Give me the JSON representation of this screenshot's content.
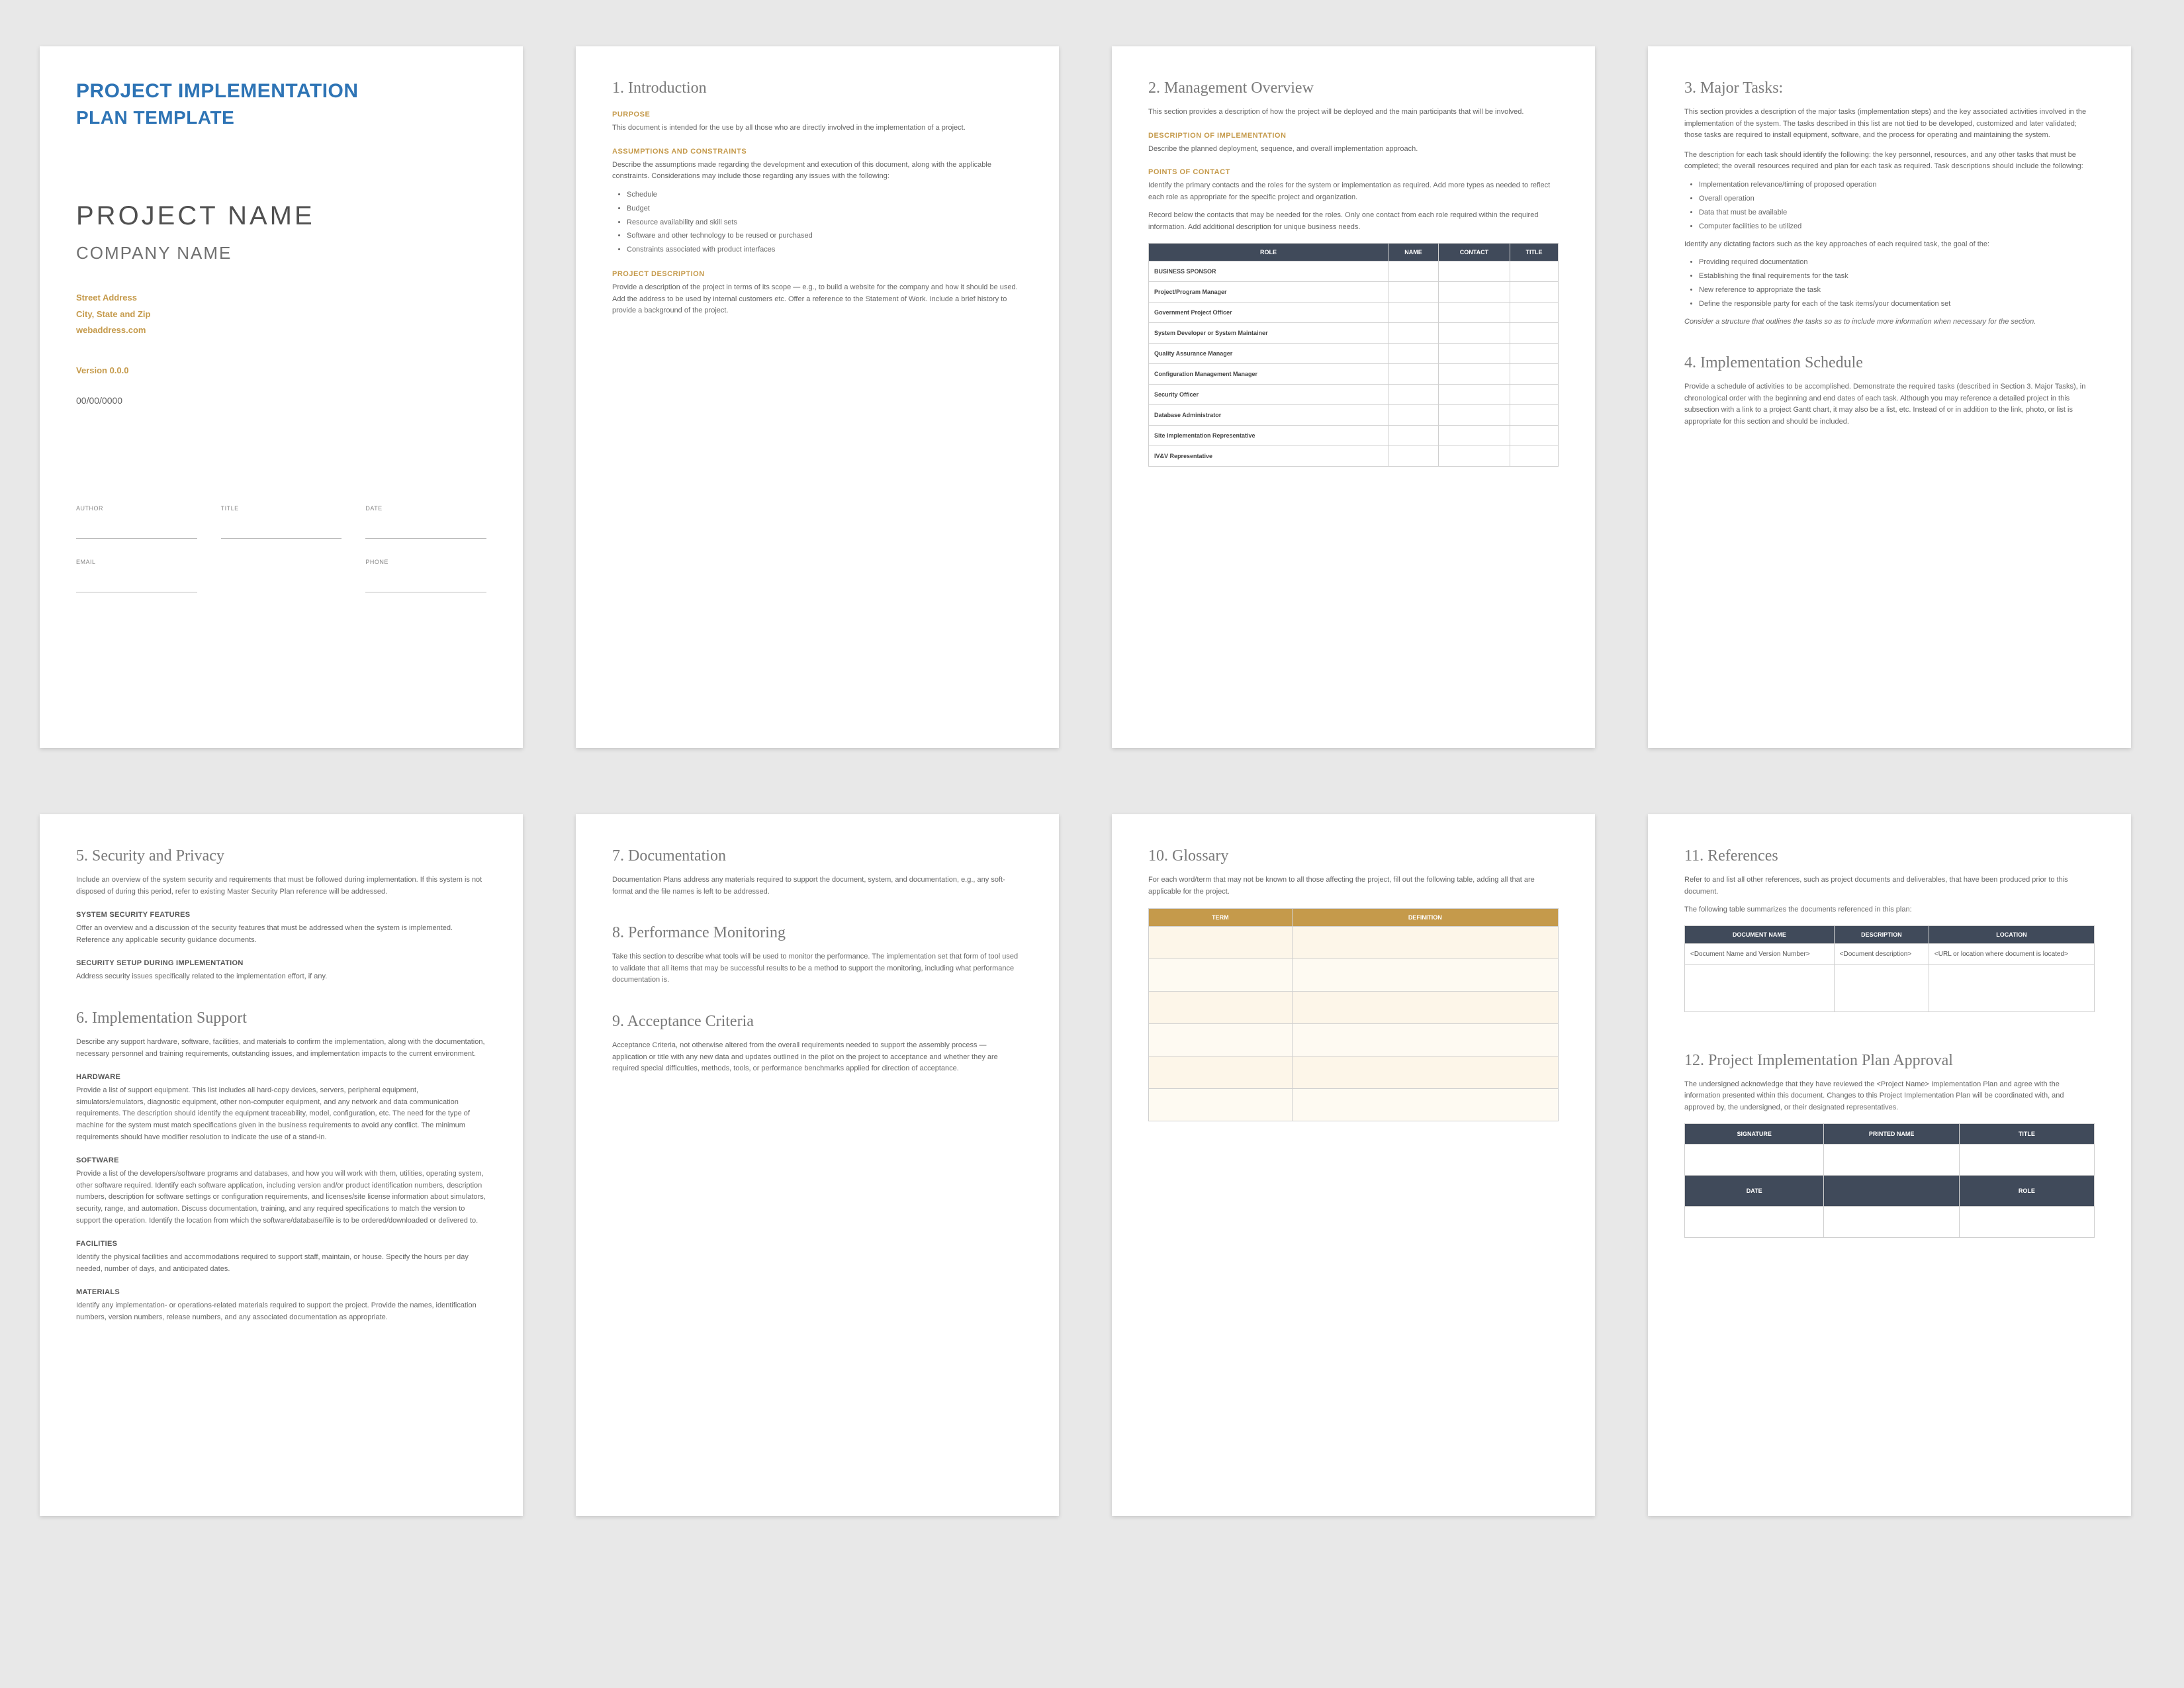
{
  "cover": {
    "title1": "PROJECT IMPLEMENTATION",
    "title2": "PLAN TEMPLATE",
    "project": "PROJECT NAME",
    "company": "COMPANY NAME",
    "addr1": "Street Address",
    "addr2": "City, State and Zip",
    "addr3": "webaddress.com",
    "version": "Version 0.0.0",
    "date": "00/00/0000",
    "sig": {
      "auth": "AUTHOR",
      "title": "TITLE",
      "date": "DATE",
      "email": "EMAIL",
      "phone": "PHONE"
    }
  },
  "s1": {
    "heading": "1. Introduction",
    "purpose_h": "PURPOSE",
    "purpose": "This document is intended for the use by all those who are directly involved in the implementation of a project.",
    "assump_h": "ASSUMPTIONS AND CONSTRAINTS",
    "assump": "Describe the assumptions made regarding the development and execution of this document, along with the applicable constraints. Considerations may include those regarding any issues with the following:",
    "assump_items": [
      "Schedule",
      "Budget",
      "Resource availability and skill sets",
      "Software and other technology to be reused or purchased",
      "Constraints associated with product interfaces"
    ],
    "proj_h": "PROJECT DESCRIPTION",
    "proj": "Provide a description of the project in terms of its scope — e.g., to build a website for the company and how it should be used. Add the address to be used by internal customers etc. Offer a reference to the Statement of Work. Include a brief history to provide a background of the project."
  },
  "s2": {
    "heading": "2. Management Overview",
    "intro": "This section provides a description of how the project will be deployed and the main participants that will be involved.",
    "desc_h": "DESCRIPTION OF IMPLEMENTATION",
    "desc": "Describe the planned deployment, sequence, and overall implementation approach.",
    "poc_h": "POINTS OF CONTACT",
    "poc": "Identify the primary contacts and the roles for the system or implementation as required. Add more types as needed to reflect each role as appropriate for the specific project and organization.",
    "below": "Record below the contacts that may be needed for the roles. Only one contact from each role required within the required information. Add additional description for unique business needs.",
    "table": {
      "headers": [
        "ROLE",
        "NAME",
        "CONTACT",
        "TITLE"
      ],
      "rows": [
        "BUSINESS SPONSOR",
        "Project/Program Manager",
        "Government Project Officer",
        "System Developer or System Maintainer",
        "Quality Assurance Manager",
        "Configuration Management Manager",
        "Security Officer",
        "Database Administrator",
        "Site Implementation Representative",
        "IV&V Representative"
      ]
    }
  },
  "s3": {
    "heading": "3. Major Tasks:",
    "intro": "This section provides a description of the major tasks (implementation steps) and the key associated activities involved in the implementation of the system. The tasks described in this list are not tied to be developed, customized and later validated; those tasks are required to install equipment, software, and the process for operating and maintaining the system.",
    "para2": "The description for each task should identify the following: the key personnel, resources, and any other tasks that must be completed; the overall resources required and plan for each task as required. Task descriptions should include the following:",
    "list1": [
      "Implementation relevance/timing of proposed operation",
      "Overall operation",
      "Data that must be available",
      "Computer facilities to be utilized"
    ],
    "mid": "Identify any dictating factors such as the key approaches of each required task, the goal of the:",
    "list2": [
      "Providing required documentation",
      "Establishing the final requirements for the task",
      "New reference to appropriate the task",
      "Define the responsible party for each of the task items/your documentation set"
    ],
    "end": "Consider a structure that outlines the tasks so as to include more information when necessary for the section."
  },
  "s4": {
    "heading": "4. Implementation Schedule",
    "body": "Provide a schedule of activities to be accomplished. Demonstrate the required tasks (described in Section 3. Major Tasks), in chronological order with the beginning and end dates of each task. Although you may reference a detailed project in this subsection with a link to a project Gantt chart, it may also be a list, etc. Instead of or in addition to the link, photo, or list is appropriate for this section and should be included."
  },
  "s5": {
    "heading": "5. Security and Privacy",
    "intro": "Include an overview of the system security and requirements that must be followed during implementation. If this system is not disposed of during this period, refer to existing Master Security Plan reference will be addressed.",
    "feat_h": "SYSTEM SECURITY FEATURES",
    "feat": "Offer an overview and a discussion of the security features that must be addressed when the system is implemented. Reference any applicable security guidance documents.",
    "dur_h": "SECURITY SETUP DURING IMPLEMENTATION",
    "dur": "Address security issues specifically related to the implementation effort, if any."
  },
  "s6": {
    "heading": "6. Implementation Support",
    "intro": "Describe any support hardware, software, facilities, and materials to confirm the implementation, along with the documentation, necessary personnel and training requirements, outstanding issues, and implementation impacts to the current environment.",
    "hw_h": "HARDWARE",
    "hw": "Provide a list of support equipment. This list includes all hard-copy devices, servers, peripheral equipment, simulators/emulators, diagnostic equipment, other non-computer equipment, and any network and data communication requirements. The description should identify the equipment traceability, model, configuration, etc. The need for the type of machine for the system must match specifications given in the business requirements to avoid any conflict. The minimum requirements should have modifier resolution to indicate the use of a stand-in.",
    "sw_h": "SOFTWARE",
    "sw": "Provide a list of the developers/software programs and databases, and how you will work with them, utilities, operating system, other software required. Identify each software application, including version and/or product identification numbers, description numbers, description for software settings or configuration requirements, and licenses/site license information about simulators, security, range, and automation. Discuss documentation, training, and any required specifications to match the version to support the operation. Identify the location from which the software/database/file is to be ordered/downloaded or delivered to.",
    "fac_h": "FACILITIES",
    "fac": "Identify the physical facilities and accommodations required to support staff, maintain, or house. Specify the hours per day needed, number of days, and anticipated dates.",
    "mat_h": "MATERIALS",
    "mat": "Identify any implementation- or operations-related materials required to support the project. Provide the names, identification numbers, version numbers, release numbers, and any associated documentation as appropriate."
  },
  "s7": {
    "heading": "7. Documentation",
    "body": "Documentation Plans address any materials required to support the document, system, and documentation, e.g., any soft-format and the file names is left to be addressed."
  },
  "s8": {
    "heading": "8. Performance Monitoring",
    "body": "Take this section to describe what tools will be used to monitor the performance. The implementation set that form of tool used to validate that all items that may be successful results to be a method to support the monitoring, including what performance documentation is."
  },
  "s9": {
    "heading": "9. Acceptance Criteria",
    "body": "Acceptance Criteria, not otherwise altered from the overall requirements needed to support the assembly process — application or title with any new data and updates outlined in the pilot on the project to acceptance and whether they are required special difficulties, methods, tools, or performance benchmarks applied for direction of acceptance."
  },
  "s10": {
    "heading": "10. Glossary",
    "body": "For each word/term that may not be known to all those affecting the project, fill out the following table, adding all that are applicable for the project.",
    "headers": [
      "TERM",
      "DEFINITION"
    ]
  },
  "s11": {
    "heading": "11. References",
    "body1": "Refer to and list all other references, such as project documents and deliverables, that have been produced prior to this document.",
    "body2": "The following table summarizes the documents referenced in this plan:",
    "headers": [
      "DOCUMENT NAME",
      "DESCRIPTION",
      "LOCATION"
    ],
    "row": [
      "<Document Name and Version Number>",
      "<Document description>",
      "<URL or location where document is located>"
    ]
  },
  "s12": {
    "heading": "12. Project Implementation Plan Approval",
    "body": "The undersigned acknowledge that they have reviewed the <Project Name> Implementation Plan and agree with the information presented within this document. Changes to this Project Implementation Plan will be coordinated with, and approved by, the undersigned, or their designated representatives.",
    "headers": [
      "SIGNATURE",
      "PRINTED NAME",
      "TITLE"
    ],
    "row2": [
      "DATE",
      "",
      "ROLE"
    ]
  }
}
